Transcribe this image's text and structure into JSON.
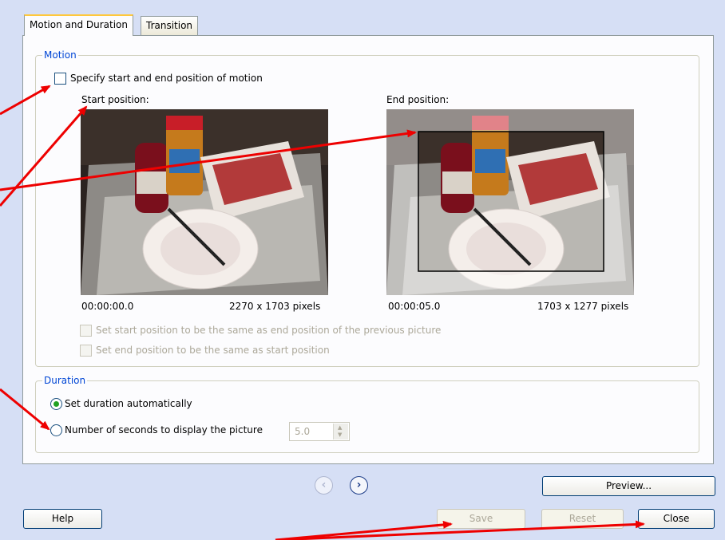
{
  "tabs": [
    {
      "label": "Motion and Duration",
      "active": true
    },
    {
      "label": "Transition",
      "active": false
    }
  ],
  "motion": {
    "legend": "Motion",
    "specify_label": "Specify start and end position of motion",
    "specify_checked": false,
    "start_label": "Start position:",
    "end_label": "End position:",
    "start_time": "00:00:00.0",
    "start_size": "2270 x 1703 pixels",
    "end_time": "00:00:05.0",
    "end_size": "1703 x 1277 pixels",
    "same_as_prev_label": "Set start position to be the same as end position of the previous picture",
    "same_as_start_label": "Set end position to be the same as start position"
  },
  "duration": {
    "legend": "Duration",
    "auto_label": "Set duration automatically",
    "seconds_label": "Number of seconds to display the picture",
    "selected": "auto",
    "seconds_value": "5.0"
  },
  "nav": {
    "prev_icon": "left-arrow-icon",
    "next_icon": "right-arrow-icon"
  },
  "buttons": {
    "preview": "Preview...",
    "help": "Help",
    "save": "Save",
    "reset": "Reset",
    "close": "Close"
  },
  "colors": {
    "annotation_arrow": "#ee0000",
    "legend": "#0046d5",
    "radio_dot": "#21a121"
  }
}
